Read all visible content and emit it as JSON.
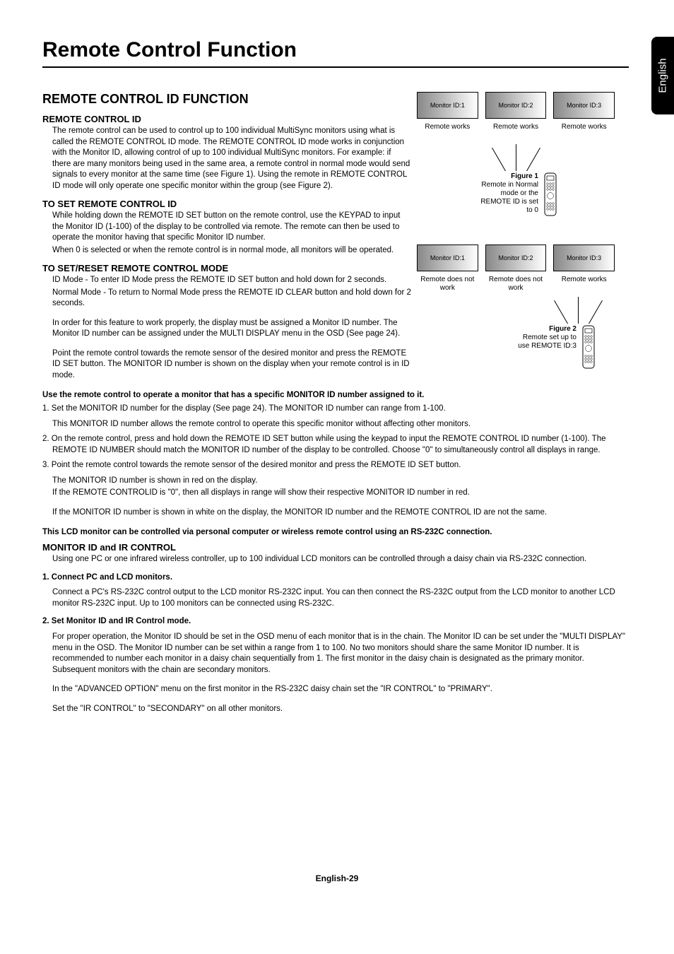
{
  "sideTab": "English",
  "mainTitle": "Remote Control Function",
  "section": {
    "title": "REMOTE CONTROL ID FUNCTION",
    "remoteId": {
      "title": "REMOTE CONTROL ID",
      "p1": "The remote control can be used to control up to 100 individual MultiSync monitors using what is called the REMOTE CONTROL ID mode. The REMOTE CONTROL ID mode works in conjunction with the Monitor ID, allowing control of up to 100 individual MultiSync monitors. For example: if there are many monitors being used in the same area, a remote control in normal mode would send signals to every monitor at the same time (see Figure 1). Using the remote in REMOTE CONTROL ID mode will only operate one specific monitor within the group (see Figure 2)."
    },
    "toSet": {
      "title": "TO SET REMOTE CONTROL ID",
      "p1": "While holding down the REMOTE ID SET button on the remote control, use the KEYPAD to input the Monitor ID (1-100) of the display to be controlled via remote. The remote can then be used to operate the monitor having that specific Monitor ID number.",
      "p2": "When 0 is selected or when the remote control is in normal mode, all monitors will be operated."
    },
    "setReset": {
      "title": "TO SET/RESET REMOTE CONTROL MODE",
      "p1": "ID Mode - To enter ID Mode press the REMOTE ID SET button and hold down for 2 seconds.",
      "p2": "Normal Mode - To return to Normal Mode press the REMOTE ID CLEAR button and hold down for 2 seconds.",
      "p3": "In order for this feature to work properly, the display must be assigned a Monitor ID number. The Monitor ID number can be assigned under the MULTI DISPLAY menu in the OSD (See page 24).",
      "p4": "Point the remote control towards the remote sensor of the desired monitor and press the REMOTE ID SET button. The MONITOR ID number is shown on the display when your remote control is in ID mode."
    },
    "useRemote": {
      "title": "Use the remote control to operate a monitor that has a specific MONITOR ID number assigned to it.",
      "i1a": "1. Set the MONITOR ID number for the display (See page 24). The MONITOR ID number can range from 1-100.",
      "i1b": "This MONITOR ID number allows the remote control to operate this specific monitor without affecting other monitors.",
      "i2": "2. On the remote control, press and hold down the REMOTE ID SET button while using the keypad to input the REMOTE CONTROL ID number (1-100). The REMOTE ID NUMBER should match the MONITOR ID number of the display to be controlled. Choose \"0\" to simultaneously control all displays in range.",
      "i3a": "3. Point the remote control towards the remote sensor of the desired monitor and press the REMOTE ID SET button.",
      "i3b": "The MONITOR ID number is shown in red on the display.",
      "i3c": "If the REMOTE CONTROLID is \"0\", then all displays in range will show their respective MONITOR ID number in red.",
      "i3d": "If the MONITOR ID number is shown in white on the display, the MONITOR ID number and the REMOTE CONTROL ID are not the same."
    },
    "rs232": {
      "title": "This LCD monitor can be controlled via personal computer or wireless remote control using an RS-232C connection.",
      "monIr": {
        "title": "MONITOR ID and IR CONTROL",
        "p1": "Using one PC or one infrared wireless controller, up to 100 individual LCD monitors can be controlled through a daisy chain via RS-232C connection."
      },
      "s1": {
        "title": "1. Connect PC and LCD monitors.",
        "p1": "Connect a PC's RS-232C control output to the LCD monitor RS-232C input. You can then connect the RS-232C output from the LCD monitor to another LCD monitor RS-232C input. Up to 100 monitors can be connected using RS-232C."
      },
      "s2": {
        "title": "2. Set Monitor ID and IR Control mode.",
        "p1": "For proper operation, the Monitor ID should be set in the OSD menu of each monitor that is in the chain. The Monitor ID can be set under the \"MULTI DISPLAY\" menu in the OSD. The Monitor ID number can be set within a range from 1 to 100. No two monitors should share the same Monitor ID number. It is recommended to number each monitor in a daisy chain sequentially from 1. The first monitor in the daisy chain is designated as the primary monitor. Subsequent monitors with the chain are secondary monitors.",
        "p2": "In the \"ADVANCED OPTION\" menu on the first monitor in the RS-232C daisy chain set the \"IR CONTROL\" to \"PRIMARY\".",
        "p3": "Set the \"IR CONTROL\" to \"SECONDARY\" on all other monitors."
      }
    }
  },
  "figures": {
    "f1": {
      "m1": "Monitor ID:1",
      "m2": "Monitor ID:2",
      "m3": "Monitor ID:3",
      "l1": "Remote works",
      "l2": "Remote works",
      "l3": "Remote works",
      "captionBold": "Figure 1",
      "caption": "Remote in Normal mode or the REMOTE ID is set to 0"
    },
    "f2": {
      "m1": "Monitor ID:1",
      "m2": "Monitor ID:2",
      "m3": "Monitor ID:3",
      "l1": "Remote does not work",
      "l2": "Remote does not work",
      "l3": "Remote works",
      "captionBold": "Figure 2",
      "caption": "Remote set up to use REMOTE ID:3"
    }
  },
  "footer": "English-29"
}
